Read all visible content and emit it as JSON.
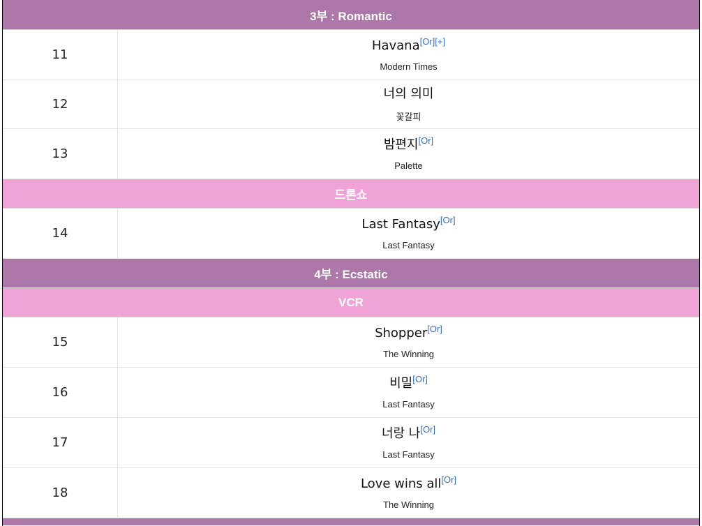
{
  "sections": {
    "part3": "3부 : Romantic",
    "drone": "드론쇼",
    "part4": "4부 : Ecstatic",
    "vcr": "VCR"
  },
  "songs": [
    {
      "num": "11",
      "title": "Havana",
      "album": "Modern Times",
      "refs": [
        "[Or]",
        "[+]"
      ]
    },
    {
      "num": "12",
      "title": "너의 의미",
      "album": "꽃갈피",
      "refs": []
    },
    {
      "num": "13",
      "title": "밤편지",
      "album": "Palette",
      "refs": [
        "[Or]"
      ]
    },
    {
      "num": "14",
      "title": "Last Fantasy",
      "album": "Last Fantasy",
      "refs": [
        "[Or]"
      ]
    },
    {
      "num": "15",
      "title": "Shopper",
      "album": "The Winning",
      "refs": [
        "[Or]"
      ]
    },
    {
      "num": "16",
      "title": "비밀",
      "album": "Last Fantasy",
      "refs": [
        "[Or]"
      ]
    },
    {
      "num": "17",
      "title": "너랑 나",
      "album": "Last Fantasy",
      "refs": [
        "[Or]"
      ]
    },
    {
      "num": "18",
      "title": "Love wins all",
      "album": "The Winning",
      "refs": [
        "[Or]"
      ]
    }
  ],
  "colors": {
    "part_header": "#ad77aa",
    "segment_header": "#f0a3d6",
    "link": "#2f6fd0"
  }
}
